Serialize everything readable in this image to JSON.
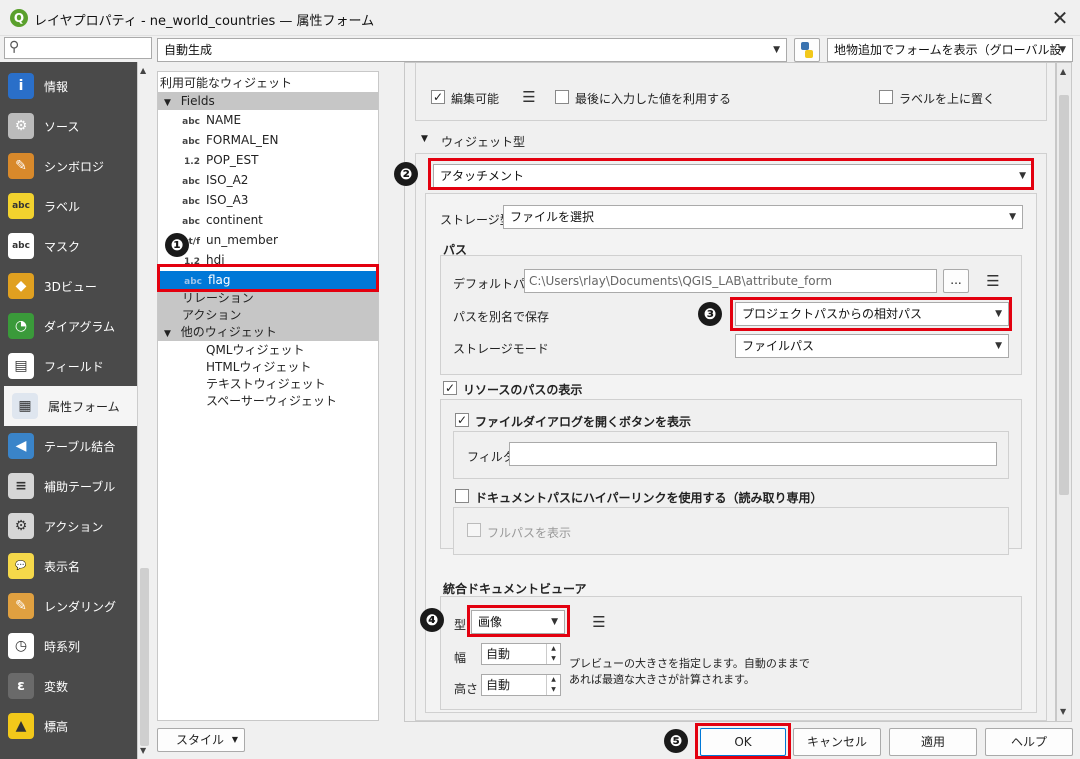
{
  "window": {
    "title": "レイヤプロパティ - ne_world_countries — 属性フォーム",
    "close_glyph": "✕"
  },
  "search": {
    "placeholder": ""
  },
  "toolbar": {
    "layout_mode": "自動生成",
    "form_option": "地物追加でフォームを表示（グローバル設定）"
  },
  "sidebar": {
    "items": [
      {
        "label": "情報",
        "icon": "info-icon"
      },
      {
        "label": "ソース",
        "icon": "source-icon"
      },
      {
        "label": "シンボロジ",
        "icon": "symbology-icon"
      },
      {
        "label": "ラベル",
        "icon": "labels-icon"
      },
      {
        "label": "マスク",
        "icon": "mask-icon"
      },
      {
        "label": "3Dビュー",
        "icon": "3d-view-icon"
      },
      {
        "label": "ダイアグラム",
        "icon": "diagram-icon"
      },
      {
        "label": "フィールド",
        "icon": "fields-icon"
      },
      {
        "label": "属性フォーム",
        "icon": "attribute-form-icon",
        "active": true
      },
      {
        "label": "テーブル結合",
        "icon": "joins-icon"
      },
      {
        "label": "補助テーブル",
        "icon": "auxiliary-storage-icon"
      },
      {
        "label": "アクション",
        "icon": "actions-icon"
      },
      {
        "label": "表示名",
        "icon": "display-icon"
      },
      {
        "label": "レンダリング",
        "icon": "rendering-icon"
      },
      {
        "label": "時系列",
        "icon": "temporal-icon"
      },
      {
        "label": "変数",
        "icon": "variables-icon"
      },
      {
        "label": "標高",
        "icon": "elevation-icon"
      }
    ]
  },
  "tree": {
    "header": "利用可能なウィジェット",
    "fields_label": "Fields",
    "fields": [
      {
        "type": "abc",
        "name": "NAME"
      },
      {
        "type": "abc",
        "name": "FORMAL_EN"
      },
      {
        "type": "1.2",
        "name": "POP_EST"
      },
      {
        "type": "abc",
        "name": "ISO_A2"
      },
      {
        "type": "abc",
        "name": "ISO_A3"
      },
      {
        "type": "abc",
        "name": "continent"
      },
      {
        "type": "t/f",
        "name": "un_member"
      },
      {
        "type": "1.2",
        "name": "hdi"
      },
      {
        "type": "abc",
        "name": "flag"
      }
    ],
    "relations_label": "リレーション",
    "actions_label": "アクション",
    "other_label": "他のウィジェット",
    "other_items": [
      "QMLウィジェット",
      "HTMLウィジェット",
      "テキストウィジェット",
      "スペーサーウィジェット"
    ]
  },
  "general": {
    "editable_label": "編集可能",
    "reuse_last_label": "最後に入力した値を利用する",
    "label_on_top": "ラベルを上に置く"
  },
  "widget_type": {
    "section_label": "ウィジェット型",
    "selected": "アタッチメント",
    "storage_type_label": "ストレージ型",
    "storage_type_value": "ファイルを選択",
    "path_section": "パス",
    "default_path_label": "デフォルトパス",
    "default_path_value": "C:\\Users\\rlay\\Documents\\QGIS_LAB\\attribute_form",
    "browse_label": "...",
    "store_path_label": "パスを別名で保存",
    "store_path_value": "プロジェクトパスからの相対パス",
    "storage_mode_label": "ストレージモード",
    "storage_mode_value": "ファイルパス",
    "resource_path_label": "リソースのパスの表示",
    "file_dialog_label": "ファイルダイアログを開くボタンを表示",
    "filter_label": "フィルタ",
    "filter_value": "",
    "hyperlink_label": "ドキュメントパスにハイパーリンクを使用する（読み取り専用）",
    "full_path_label": "フルパスを表示",
    "viewer_section": "統合ドキュメントビューア",
    "viewer_type_label": "型",
    "viewer_type_value": "画像",
    "width_label": "幅",
    "width_value": "自動",
    "height_label": "高さ",
    "height_value": "自動",
    "preview_hint_line1": "プレビューの大きさを指定します。自動のままで",
    "preview_hint_line2": "あれば最適な大きさが計算されます。"
  },
  "markers": [
    "❶",
    "❷",
    "❸",
    "❹",
    "❺"
  ],
  "footer": {
    "style_label": "スタイル",
    "ok": "OK",
    "cancel": "キャンセル",
    "apply": "適用",
    "help": "ヘルプ"
  },
  "colors": {
    "highlight_red": "#e3000f",
    "selection_blue": "#0078d7",
    "sidebar_bg": "#4a4a4a"
  }
}
